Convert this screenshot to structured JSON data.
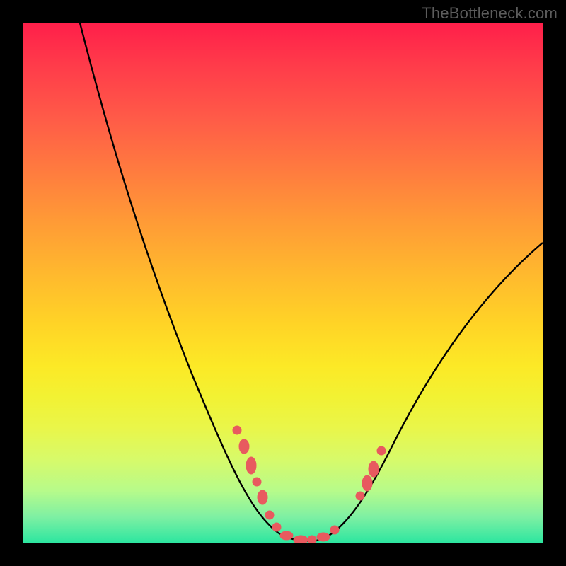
{
  "watermark": "TheBottleneck.com",
  "colors": {
    "frame": "#000000",
    "curve": "#000000",
    "markers": "#e85a5f",
    "gradient_top": "#ff1f4a",
    "gradient_bottom": "#2de6a0"
  },
  "chart_data": {
    "type": "line",
    "title": "",
    "xlabel": "",
    "ylabel": "",
    "xlim": [
      0,
      100
    ],
    "ylim": [
      0,
      100
    ],
    "grid": false,
    "legend": false,
    "series": [
      {
        "name": "bottleneck-curve",
        "x": [
          0,
          5,
          10,
          15,
          20,
          25,
          30,
          35,
          40,
          45,
          47,
          49,
          51,
          53,
          55,
          57,
          60,
          63,
          66,
          70,
          75,
          80,
          85,
          90,
          95,
          100
        ],
        "y": [
          110,
          98,
          87,
          76,
          65,
          54,
          43,
          32,
          22,
          12,
          8,
          4,
          2,
          1,
          1,
          2,
          4,
          8,
          13,
          20,
          29,
          37,
          44,
          50,
          55,
          59
        ]
      },
      {
        "name": "marker-cluster",
        "x": [
          40,
          42,
          43,
          44,
          45,
          46,
          48,
          50,
          52,
          54,
          56,
          58,
          60,
          61,
          62,
          64,
          66
        ],
        "y": [
          22,
          19,
          17,
          15,
          12,
          10,
          5,
          2,
          1,
          1,
          2,
          3,
          4,
          6,
          9,
          13,
          18
        ]
      }
    ],
    "annotations": []
  }
}
